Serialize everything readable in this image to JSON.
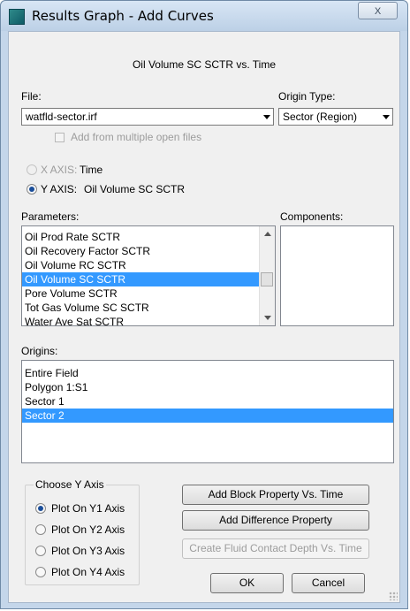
{
  "window": {
    "title": "Results Graph - Add Curves",
    "close_label": "X"
  },
  "graph_title": "Oil Volume SC SCTR vs. Time",
  "file": {
    "label": "File:",
    "value": "watfld-sector.irf",
    "multiple_open_files_label": "Add from multiple open files",
    "multiple_open_files_checked": false
  },
  "origin_type": {
    "label": "Origin Type:",
    "value": "Sector (Region)"
  },
  "axes": {
    "x_axis_label": "X AXIS:",
    "x_axis_value": "Time",
    "y_axis_label": "Y AXIS:",
    "y_axis_value": "Oil Volume SC SCTR",
    "selected": "y"
  },
  "parameters": {
    "label": "Parameters:",
    "items": [
      "Oil Prod Rate SCTR",
      "Oil Recovery Factor SCTR",
      "Oil Volume RC SCTR",
      "Oil Volume SC SCTR",
      "Pore Volume SCTR",
      "Tot Gas Volume SC SCTR",
      "Water Ave Sat SCTR"
    ],
    "selected_index": 3
  },
  "components": {
    "label": "Components:",
    "items": []
  },
  "origins": {
    "label": "Origins:",
    "items": [
      "Entire  Field",
      "Polygon 1:S1",
      "Sector 1",
      "Sector 2"
    ],
    "selected_index": 3
  },
  "choose_y_axis": {
    "title": "Choose Y Axis",
    "options": [
      "Plot On Y1 Axis",
      "Plot On Y2 Axis",
      "Plot On Y3 Axis",
      "Plot On Y4 Axis"
    ],
    "selected_index": 0
  },
  "buttons": {
    "add_block_property": "Add Block Property Vs. Time",
    "add_difference_property": "Add Difference Property",
    "create_fluid_contact": "Create Fluid Contact Depth Vs. Time",
    "ok": "OK",
    "cancel": "Cancel"
  },
  "colors": {
    "selection": "#3399ff",
    "dialog_bg": "#f0f0f0",
    "frame": "#c4d6ea"
  }
}
